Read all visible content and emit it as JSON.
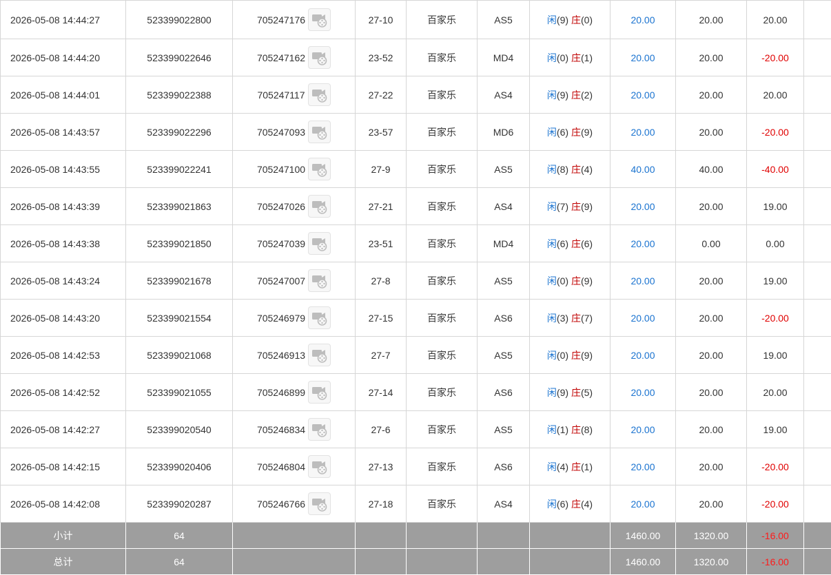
{
  "rows": [
    {
      "time": "2026-05-08 14:44:27",
      "order": "523399022800",
      "game_id": "705247176",
      "round": "27-10",
      "game": "百家乐",
      "table": "AS5",
      "player_label": "闲",
      "player_score": "(9)",
      "banker_label": "庄",
      "banker_score": "(0)",
      "bet": "20.00",
      "valid": "20.00",
      "result": "20.00",
      "result_neg": false
    },
    {
      "time": "2026-05-08 14:44:20",
      "order": "523399022646",
      "game_id": "705247162",
      "round": "23-52",
      "game": "百家乐",
      "table": "MD4",
      "player_label": "闲",
      "player_score": "(0)",
      "banker_label": "庄",
      "banker_score": "(1)",
      "bet": "20.00",
      "valid": "20.00",
      "result": "-20.00",
      "result_neg": true
    },
    {
      "time": "2026-05-08 14:44:01",
      "order": "523399022388",
      "game_id": "705247117",
      "round": "27-22",
      "game": "百家乐",
      "table": "AS4",
      "player_label": "闲",
      "player_score": "(9)",
      "banker_label": "庄",
      "banker_score": "(2)",
      "bet": "20.00",
      "valid": "20.00",
      "result": "20.00",
      "result_neg": false
    },
    {
      "time": "2026-05-08 14:43:57",
      "order": "523399022296",
      "game_id": "705247093",
      "round": "23-57",
      "game": "百家乐",
      "table": "MD6",
      "player_label": "闲",
      "player_score": "(6)",
      "banker_label": "庄",
      "banker_score": "(9)",
      "bet": "20.00",
      "valid": "20.00",
      "result": "-20.00",
      "result_neg": true
    },
    {
      "time": "2026-05-08 14:43:55",
      "order": "523399022241",
      "game_id": "705247100",
      "round": "27-9",
      "game": "百家乐",
      "table": "AS5",
      "player_label": "闲",
      "player_score": "(8)",
      "banker_label": "庄",
      "banker_score": "(4)",
      "bet": "40.00",
      "valid": "40.00",
      "result": "-40.00",
      "result_neg": true
    },
    {
      "time": "2026-05-08 14:43:39",
      "order": "523399021863",
      "game_id": "705247026",
      "round": "27-21",
      "game": "百家乐",
      "table": "AS4",
      "player_label": "闲",
      "player_score": "(7)",
      "banker_label": "庄",
      "banker_score": "(9)",
      "bet": "20.00",
      "valid": "20.00",
      "result": "19.00",
      "result_neg": false
    },
    {
      "time": "2026-05-08 14:43:38",
      "order": "523399021850",
      "game_id": "705247039",
      "round": "23-51",
      "game": "百家乐",
      "table": "MD4",
      "player_label": "闲",
      "player_score": "(6)",
      "banker_label": "庄",
      "banker_score": "(6)",
      "bet": "20.00",
      "valid": "0.00",
      "result": "0.00",
      "result_neg": false
    },
    {
      "time": "2026-05-08 14:43:24",
      "order": "523399021678",
      "game_id": "705247007",
      "round": "27-8",
      "game": "百家乐",
      "table": "AS5",
      "player_label": "闲",
      "player_score": "(0)",
      "banker_label": "庄",
      "banker_score": "(9)",
      "bet": "20.00",
      "valid": "20.00",
      "result": "19.00",
      "result_neg": false
    },
    {
      "time": "2026-05-08 14:43:20",
      "order": "523399021554",
      "game_id": "705246979",
      "round": "27-15",
      "game": "百家乐",
      "table": "AS6",
      "player_label": "闲",
      "player_score": "(3)",
      "banker_label": "庄",
      "banker_score": "(7)",
      "bet": "20.00",
      "valid": "20.00",
      "result": "-20.00",
      "result_neg": true
    },
    {
      "time": "2026-05-08 14:42:53",
      "order": "523399021068",
      "game_id": "705246913",
      "round": "27-7",
      "game": "百家乐",
      "table": "AS5",
      "player_label": "闲",
      "player_score": "(0)",
      "banker_label": "庄",
      "banker_score": "(9)",
      "bet": "20.00",
      "valid": "20.00",
      "result": "19.00",
      "result_neg": false
    },
    {
      "time": "2026-05-08 14:42:52",
      "order": "523399021055",
      "game_id": "705246899",
      "round": "27-14",
      "game": "百家乐",
      "table": "AS6",
      "player_label": "闲",
      "player_score": "(9)",
      "banker_label": "庄",
      "banker_score": "(5)",
      "bet": "20.00",
      "valid": "20.00",
      "result": "20.00",
      "result_neg": false
    },
    {
      "time": "2026-05-08 14:42:27",
      "order": "523399020540",
      "game_id": "705246834",
      "round": "27-6",
      "game": "百家乐",
      "table": "AS5",
      "player_label": "闲",
      "player_score": "(1)",
      "banker_label": "庄",
      "banker_score": "(8)",
      "bet": "20.00",
      "valid": "20.00",
      "result": "19.00",
      "result_neg": false
    },
    {
      "time": "2026-05-08 14:42:15",
      "order": "523399020406",
      "game_id": "705246804",
      "round": "27-13",
      "game": "百家乐",
      "table": "AS6",
      "player_label": "闲",
      "player_score": "(4)",
      "banker_label": "庄",
      "banker_score": "(1)",
      "bet": "20.00",
      "valid": "20.00",
      "result": "-20.00",
      "result_neg": true
    },
    {
      "time": "2026-05-08 14:42:08",
      "order": "523399020287",
      "game_id": "705246766",
      "round": "27-18",
      "game": "百家乐",
      "table": "AS4",
      "player_label": "闲",
      "player_score": "(6)",
      "banker_label": "庄",
      "banker_score": "(4)",
      "bet": "20.00",
      "valid": "20.00",
      "result": "-20.00",
      "result_neg": true
    }
  ],
  "subtotal": {
    "label": "小计",
    "count": "64",
    "bet": "1460.00",
    "valid": "1320.00",
    "result": "-16.00"
  },
  "total": {
    "label": "总计",
    "count": "64",
    "bet": "1460.00",
    "valid": "1320.00",
    "result": "-16.00"
  },
  "icons": {
    "video": "video-replay-icon"
  },
  "colors": {
    "blue": "#1a73d0",
    "red": "#e00000",
    "dealer": "#c00000",
    "summary_bg": "#9e9e9e"
  }
}
